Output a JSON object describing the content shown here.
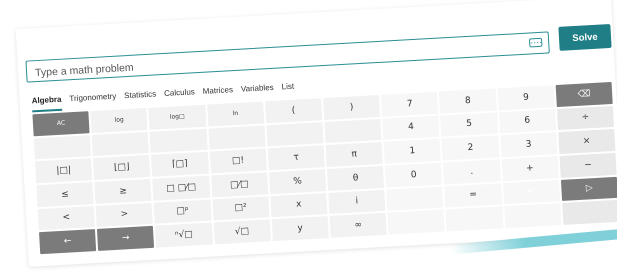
{
  "input": {
    "placeholder": "Type a math problem"
  },
  "solve_label": "Solve",
  "tabs": [
    "Algebra",
    "Trigonometry",
    "Statistics",
    "Calculus",
    "Matrices",
    "Variables",
    "List"
  ],
  "active_tab": "Algebra",
  "keys": [
    [
      "AC",
      "log",
      "log□",
      "ln",
      "(",
      ")",
      "7",
      "8",
      "9",
      "⌫"
    ],
    [
      "",
      "",
      "",
      "",
      "",
      "",
      "4",
      "5",
      "6",
      "÷"
    ],
    [
      "|□|",
      "⌊□⌋",
      "⌈□⌉",
      "□!",
      "τ",
      "π",
      "1",
      "2",
      "3",
      "×"
    ],
    [
      "≤",
      "≥",
      "□ □⁄□",
      "□⁄□",
      "%",
      "θ",
      "0",
      ".",
      "+",
      "−"
    ],
    [
      "<",
      ">",
      "□ᵖ",
      "□²",
      "x",
      "i",
      "",
      "=",
      "↵",
      "▷"
    ],
    [
      "←",
      "→",
      "ⁿ√□",
      "√□",
      "y",
      "∞",
      "",
      "",
      "",
      ""
    ]
  ],
  "colors": {
    "accent": "#1f7e86",
    "dark_key": "#7b7b7b",
    "key": "#f2f2f2"
  }
}
